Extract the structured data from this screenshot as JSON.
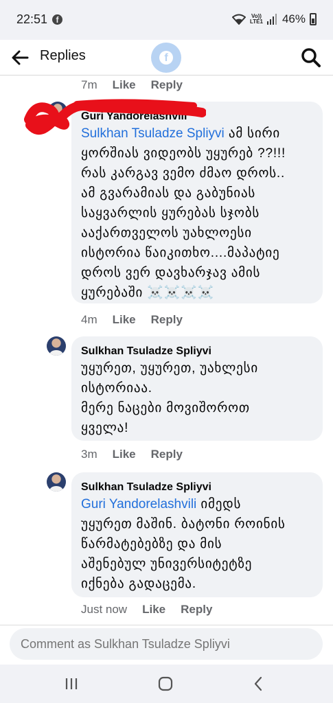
{
  "status": {
    "time": "22:51",
    "battery": "46%",
    "volte_top": "Vo))",
    "volte_bottom": "LTE1"
  },
  "header": {
    "title": "Replies"
  },
  "comments": [
    {
      "time": "7m",
      "like": "Like",
      "reply": "Reply"
    },
    {
      "author": "Guri Yandorelashvili",
      "mention": "Sulkhan Tsuladze Spliyvi",
      "text": "ამ სირი\nყორშიას ვიდეობს უყურებ ??!!!\nრას კარგავ ვემო ძმაო დროს..\nამ გვარამიას და გაბუნიას\nსაყვარლის ყურებას სჯობს\nააქართველოს უახლოესი\nისტორია წაიკითხო....მაპატიე\nდროს ვერ დავხარჯავ ამის\nყურებაში ☠️☠️☠️☠️",
      "time": "4m",
      "like": "Like",
      "reply": "Reply"
    },
    {
      "author": "Sulkhan Tsuladze Spliyvi",
      "text": "უყურეთ, უყურეთ, უახლესი\nისტორიაა.\nმერე ნაცები მოვიშოროთ\nყველა!",
      "time": "3m",
      "like": "Like",
      "reply": "Reply"
    },
    {
      "author": "Sulkhan Tsuladze Spliyvi",
      "mention": "Guri Yandorelashvili",
      "text": "იმედს\nუყურეთ მაშინ. ბატონი როინის\nწარმატებებზე და მის\nაშენებულ უნივერსიტეტზე\nიქნება გადაცემა.",
      "time": "Just now",
      "like": "Like",
      "reply": "Reply"
    }
  ],
  "composer": {
    "placeholder": "Comment as Sulkhan Tsuladze Spliyvi"
  },
  "colors": {
    "bubble": "#f0f2f5",
    "mention": "#216fdb",
    "redaction": "#e8101a"
  }
}
